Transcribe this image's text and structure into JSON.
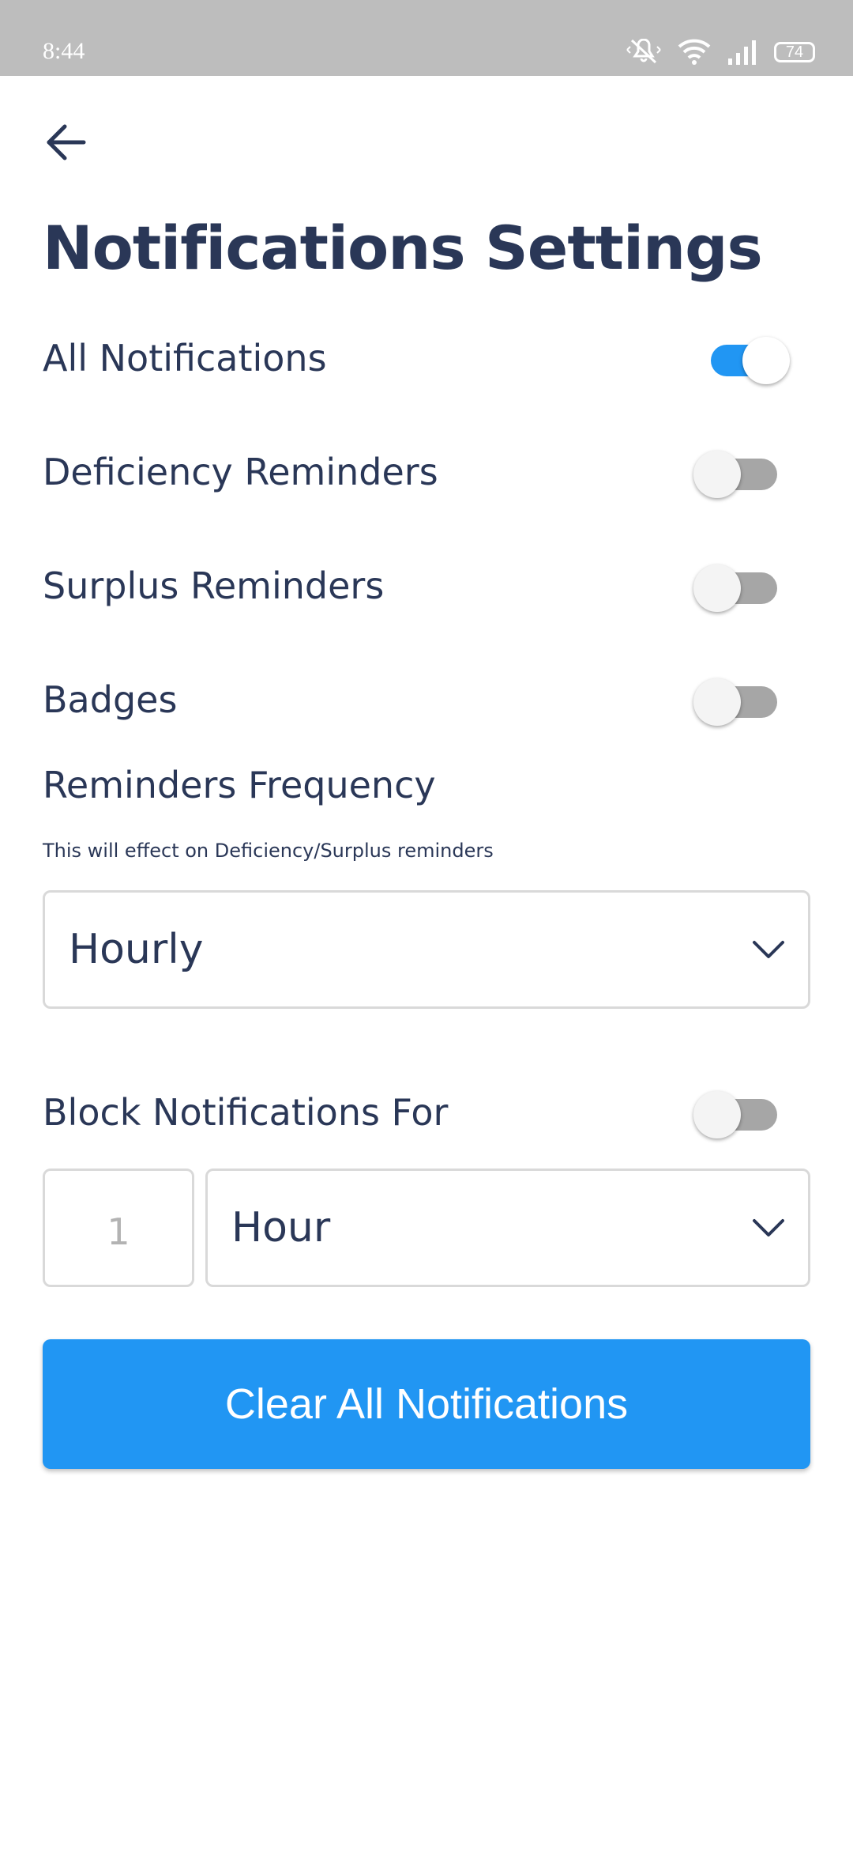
{
  "status_bar": {
    "time": "8:44",
    "battery": "74",
    "icons": [
      "mute-icon",
      "wifi-icon",
      "signal-icon",
      "battery-icon"
    ]
  },
  "header": {
    "back_icon": "arrow-left-icon",
    "title": "Notifications Settings"
  },
  "settings": {
    "all_notifications": {
      "label": "All Notifications",
      "enabled": true
    },
    "deficiency_reminders": {
      "label": "Deficiency Reminders",
      "enabled": false
    },
    "surplus_reminders": {
      "label": "Surplus Reminders",
      "enabled": false
    },
    "badges": {
      "label": "Badges",
      "enabled": false
    }
  },
  "frequency": {
    "label": "Reminders Frequency",
    "helper": "This will effect on Deficiency/Surplus reminders",
    "selected": "Hourly"
  },
  "block": {
    "label": "Block Notifications For",
    "enabled": false,
    "amount_placeholder": "1",
    "unit_selected": "Hour"
  },
  "clear_button": {
    "label": "Clear All Notifications"
  },
  "colors": {
    "accent": "#2196f3",
    "text": "#2a3757",
    "status_bar": "#bdbdbd",
    "toggle_off_track": "#a6a6a6"
  }
}
